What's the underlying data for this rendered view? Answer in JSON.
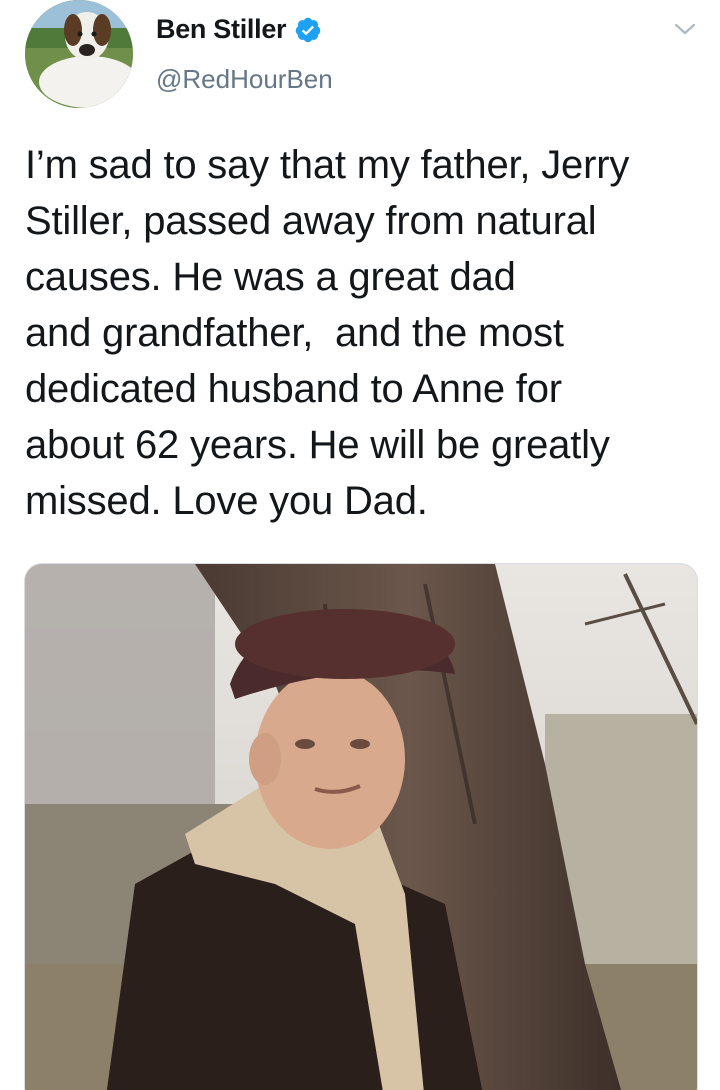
{
  "author": {
    "display_name": "Ben Stiller",
    "handle": "@RedHourBen",
    "verified": true
  },
  "tweet": {
    "lines": [
      "I’m sad to say that my father, Jerry",
      "Stiller, passed away from natural",
      "causes. He was a great dad",
      "and grandfather,  and the most",
      "dedicated husband to Anne for",
      "about 62 years. He will be greatly",
      "missed. Love you Dad."
    ]
  },
  "icons": {
    "verified": "verified-badge-icon",
    "menu": "chevron-down-icon"
  },
  "colors": {
    "verified_blue": "#1da1f2",
    "handle_gray": "#657786",
    "text": "#14171a"
  }
}
